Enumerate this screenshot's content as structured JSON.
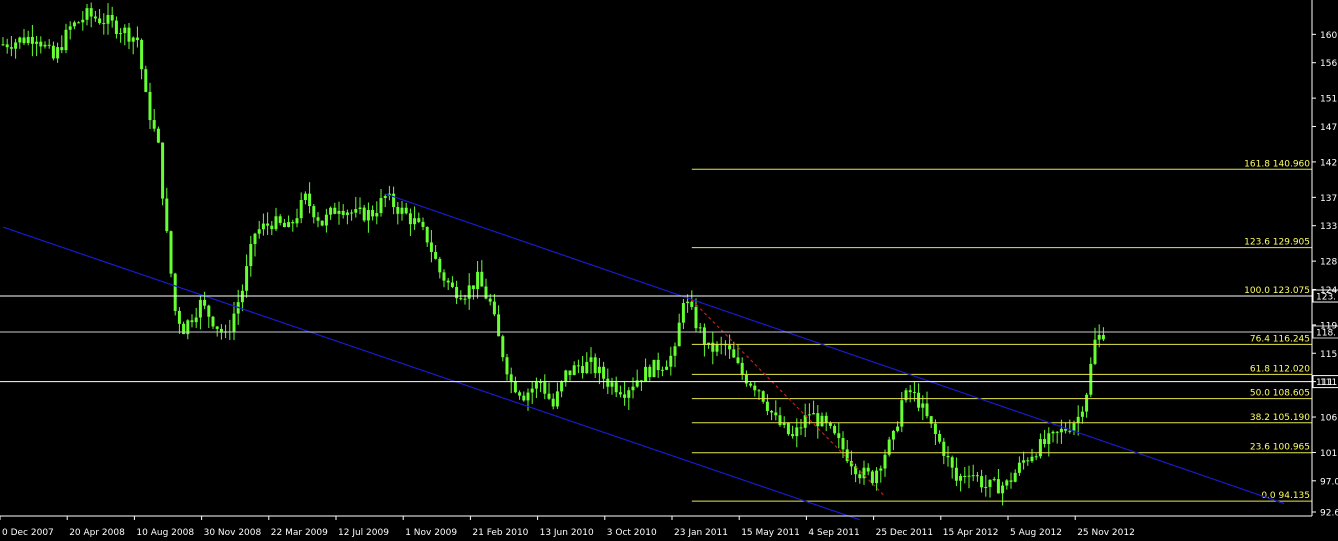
{
  "chart_data": {
    "type": "candlestick",
    "title": "",
    "xlabel": "",
    "ylabel": "",
    "ylim": [
      92.6,
      164.0
    ],
    "grid": false,
    "legend": "none",
    "y_ticks": [
      "160.",
      "156.",
      "151.",
      "147.",
      "142.",
      "137.",
      "133.",
      "128.",
      "124.",
      "119.",
      "115.",
      "111.",
      "106.",
      "101.",
      "97.0",
      "92.6"
    ],
    "y_tick_values": [
      160.0,
      156.0,
      151.0,
      147.0,
      142.0,
      137.0,
      133.0,
      128.0,
      124.0,
      119.0,
      115.0,
      111.0,
      106.0,
      101.0,
      97.0,
      92.6
    ],
    "x_ticks": [
      "0 Dec 2007",
      "20 Apr 2008",
      "10 Aug 2008",
      "30 Nov 2008",
      "22 Mar 2009",
      "12 Jul 2009",
      "1 Nov 2009",
      "21 Feb 2010",
      "13 Jun 2010",
      "3 Oct 2010",
      "23 Jan 2011",
      "15 May 2011",
      "4 Sep 2011",
      "25 Dec 2011",
      "15 Apr 2012",
      "5 Aug 2012",
      "25 Nov 2012"
    ],
    "x_tick_index": [
      0,
      16,
      32,
      48,
      64,
      80,
      96,
      112,
      128,
      144,
      160,
      176,
      192,
      208,
      224,
      240,
      256
    ],
    "series_color": "#66ff33",
    "series": [
      {
        "name": "",
        "path": [
          [
            0,
            158.6
          ],
          [
            8,
            159.8
          ],
          [
            12,
            156.5
          ],
          [
            16,
            160.9
          ],
          [
            20,
            162.7
          ],
          [
            24,
            162.0
          ],
          [
            28,
            160.8
          ],
          [
            32,
            159.3
          ],
          [
            34,
            151.0
          ],
          [
            37,
            144.0
          ],
          [
            39,
            131.5
          ],
          [
            41,
            121.0
          ],
          [
            43,
            118.5
          ],
          [
            47,
            122.0
          ],
          [
            50,
            119.7
          ],
          [
            53,
            117.2
          ],
          [
            57,
            124.0
          ],
          [
            60,
            132.0
          ],
          [
            64,
            133.5
          ],
          [
            68,
            132.5
          ],
          [
            72,
            136.8
          ],
          [
            76,
            133.4
          ],
          [
            80,
            135.9
          ],
          [
            84,
            134.5
          ],
          [
            88,
            134.8
          ],
          [
            91,
            137.0
          ],
          [
            94,
            135.5
          ],
          [
            98,
            133.5
          ],
          [
            101,
            131.2
          ],
          [
            104,
            126.5
          ],
          [
            107,
            124.0
          ],
          [
            110,
            123.6
          ],
          [
            113,
            125.4
          ],
          [
            116,
            122.0
          ],
          [
            118,
            117.0
          ],
          [
            121,
            111.0
          ],
          [
            124,
            109.2
          ],
          [
            128,
            111.0
          ],
          [
            131,
            107.5
          ],
          [
            134,
            112.0
          ],
          [
            137,
            113.2
          ],
          [
            140,
            113.4
          ],
          [
            144,
            111.0
          ],
          [
            148,
            109.8
          ],
          [
            151,
            111.4
          ],
          [
            154,
            112.7
          ],
          [
            157,
            113.5
          ],
          [
            160,
            115.0
          ],
          [
            162,
            122.9
          ],
          [
            164,
            120.5
          ],
          [
            168,
            115.5
          ],
          [
            172,
            116.0
          ],
          [
            176,
            112.0
          ],
          [
            180,
            110.0
          ],
          [
            184,
            105.5
          ],
          [
            188,
            103.0
          ],
          [
            192,
            106.6
          ],
          [
            196,
            104.6
          ],
          [
            200,
            101.5
          ],
          [
            204,
            98.2
          ],
          [
            207,
            97.5
          ],
          [
            210,
            101.0
          ],
          [
            212,
            103.0
          ],
          [
            214,
            108.2
          ],
          [
            216,
            109.5
          ],
          [
            218,
            108.2
          ],
          [
            221,
            104.5
          ],
          [
            224,
            101.3
          ],
          [
            227,
            97.0
          ],
          [
            230,
            98.6
          ],
          [
            234,
            96.2
          ],
          [
            236,
            96.2
          ],
          [
            239,
            96.5
          ],
          [
            243,
            99.8
          ],
          [
            246,
            101.5
          ],
          [
            250,
            103.0
          ],
          [
            253,
            104.4
          ],
          [
            256,
            106.0
          ],
          [
            258,
            109.7
          ],
          [
            260,
            116.6
          ],
          [
            262,
            118.0
          ]
        ]
      }
    ],
    "price_lines": [
      {
        "value": 123.075,
        "label": "123.",
        "color": "#ffffff"
      },
      {
        "value": 118.0,
        "label": "118.",
        "color": "#cccccc"
      },
      {
        "value": 111.0,
        "label": "111.",
        "color": "#ffffff"
      }
    ],
    "fibonacci": {
      "color": "#e6e64d",
      "label_color": "#ffff66",
      "start_index": 164,
      "levels": [
        {
          "ratio": "161.8",
          "price": "140.960"
        },
        {
          "ratio": "123.6",
          "price": "129.905"
        },
        {
          "ratio": "100.0",
          "price": "123.075"
        },
        {
          "ratio": "76.4",
          "price": "116.245"
        },
        {
          "ratio": "61.8",
          "price": "112.020"
        },
        {
          "ratio": "50.0",
          "price": "108.605"
        },
        {
          "ratio": "38.2",
          "price": "105.190"
        },
        {
          "ratio": "23.6",
          "price": "100.965"
        },
        {
          "ratio": "0.0",
          "price": "94.135"
        }
      ]
    },
    "trendlines": [
      {
        "color": "#1a1acc",
        "from": [
          0,
          132.8
        ],
        "to": [
          204,
          91.5
        ]
      },
      {
        "color": "#1a1acc",
        "from": [
          91,
          137.5
        ],
        "to": [
          305,
          93.8
        ]
      },
      {
        "color": "#cc1a1a",
        "dashed": true,
        "from": [
          164,
          122.5
        ],
        "to": [
          210,
          94.8
        ]
      }
    ]
  }
}
